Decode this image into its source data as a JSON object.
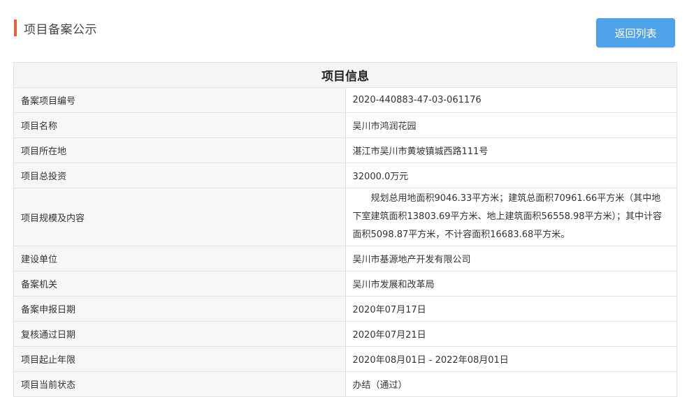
{
  "header": {
    "title": "项目备案公示",
    "back_button_label": "返回列表"
  },
  "table": {
    "title": "项目信息",
    "rows": [
      {
        "label": "备案项目编号",
        "value": "2020-440883-47-03-061176"
      },
      {
        "label": "项目名称",
        "value": "吴川市鸿润花园"
      },
      {
        "label": "项目所在地",
        "value": "湛江市吴川市黄坡镇城西路111号"
      },
      {
        "label": "项目总投资",
        "value": "32000.0万元"
      },
      {
        "label": "项目规模及内容",
        "value": "规划总用地面积9046.33平方米；建筑总面积70961.66平方米（其中地下室建筑面积13803.69平方米、地上建筑面积56558.98平方米）；其中计容面积5098.87平方米，不计容面积16683.68平方米。"
      },
      {
        "label": "建设单位",
        "value": "吴川市基源地产开发有限公司"
      },
      {
        "label": "备案机关",
        "value": "吴川市发展和改革局"
      },
      {
        "label": "备案申报日期",
        "value": "2020年07月17日"
      },
      {
        "label": "复核通过日期",
        "value": "2020年07月21日"
      },
      {
        "label": "项目起止年限",
        "value": "2020年08月01日 - 2022年08月01日"
      },
      {
        "label": "项目当前状态",
        "value": "办结（通过）"
      }
    ]
  },
  "colors": {
    "accent_bar": "#e8603c",
    "button": "#4ea3e8"
  }
}
